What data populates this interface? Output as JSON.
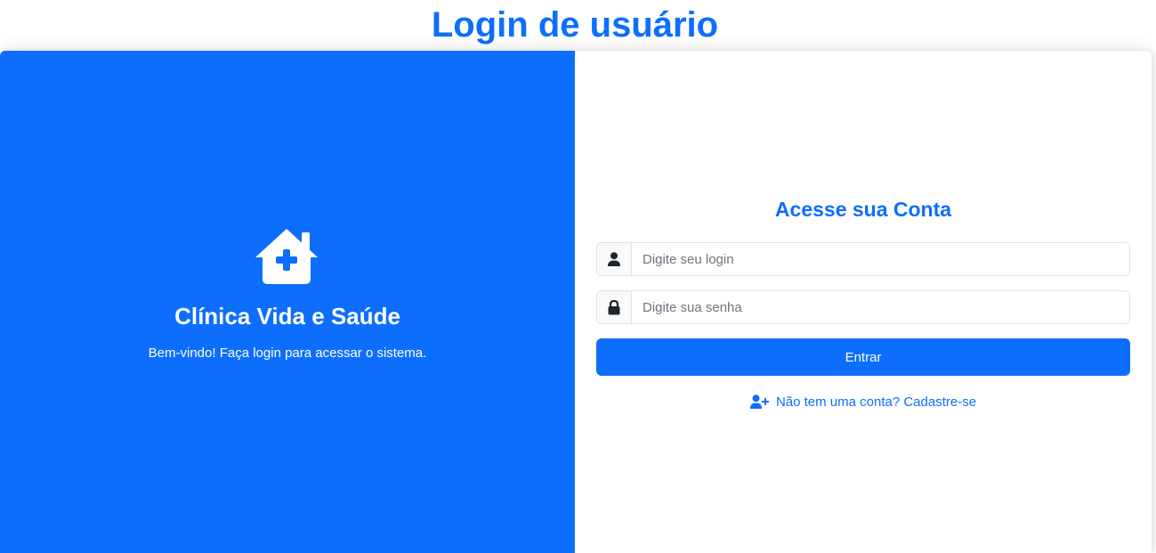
{
  "page": {
    "title": "Login de usuário"
  },
  "brand": {
    "icon": "house-medical-icon",
    "name": "Clínica Vida e Saúde",
    "welcome": "Bem-vindo! Faça login para acessar o sistema."
  },
  "form": {
    "title": "Acesse sua Conta",
    "login": {
      "icon": "user-icon",
      "placeholder": "Digite seu login",
      "value": ""
    },
    "password": {
      "icon": "lock-icon",
      "placeholder": "Digite sua senha",
      "value": ""
    },
    "submit_label": "Entrar",
    "register": {
      "icon": "user-plus-icon",
      "label": "Não tem uma conta? Cadastre-se"
    }
  },
  "colors": {
    "primary": "#0d6efd",
    "addon_bg": "#f8f9fa",
    "border": "#dee2e6",
    "icon_dark": "#212529"
  }
}
